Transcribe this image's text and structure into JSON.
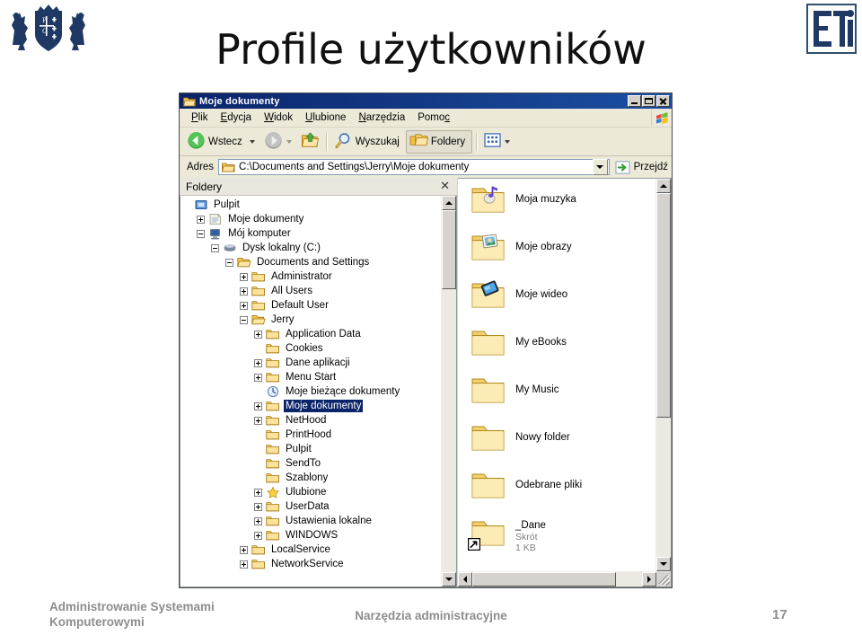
{
  "slide": {
    "title": "Profile użytkowników",
    "logo_left": "pg-coat-of-arms-logo",
    "logo_right": "eti-logo"
  },
  "footer": {
    "left_line1": "Administrowanie Systemami",
    "left_line2": "Komputerowymi",
    "center": "Narzędzia administracyjne",
    "page_number": "17"
  },
  "explorer": {
    "title": "Moje dokumenty",
    "title_icon": "folder-icon",
    "window_buttons": {
      "minimize": "minimize-button",
      "maximize": "maximize-button",
      "close": "close-button"
    },
    "menu": [
      {
        "label": "Plik",
        "accel": "P"
      },
      {
        "label": "Edycja",
        "accel": "E"
      },
      {
        "label": "Widok",
        "accel": "W"
      },
      {
        "label": "Ulubione",
        "accel": "U"
      },
      {
        "label": "Narzędzia",
        "accel": "N"
      },
      {
        "label": "Pomoc",
        "accel": "c"
      }
    ],
    "menu_logo": "windows-flag-icon",
    "toolbar": {
      "back": "Wstecz",
      "forward": "",
      "up": "up-one-level-icon",
      "search": "Wyszukaj",
      "folders": "Foldery",
      "views": "views-icon"
    },
    "address": {
      "label": "Adres",
      "value": "C:\\Documents and Settings\\Jerry\\Moje dokumenty",
      "icon": "folder-icon",
      "go_label": "Przejdź",
      "go_icon": "go-arrow-icon"
    },
    "folders_pane": {
      "title": "Foldery",
      "close_icon": "close-icon"
    },
    "tree": [
      {
        "label": "Pulpit",
        "indent": 0,
        "expander": "none",
        "icon": "desktop-icon",
        "selected": false
      },
      {
        "label": "Moje dokumenty",
        "indent": 1,
        "expander": "plus",
        "icon": "mydocs-icon",
        "selected": false
      },
      {
        "label": "Mój komputer",
        "indent": 1,
        "expander": "minus",
        "icon": "mycomputer-icon",
        "selected": false
      },
      {
        "label": "Dysk lokalny (C:)",
        "indent": 2,
        "expander": "minus",
        "icon": "harddrive-icon",
        "selected": false
      },
      {
        "label": "Documents and Settings",
        "indent": 3,
        "expander": "minus",
        "icon": "folder-open-icon",
        "selected": false
      },
      {
        "label": "Administrator",
        "indent": 4,
        "expander": "plus",
        "icon": "folder-icon",
        "selected": false
      },
      {
        "label": "All Users",
        "indent": 4,
        "expander": "plus",
        "icon": "folder-icon",
        "selected": false
      },
      {
        "label": "Default User",
        "indent": 4,
        "expander": "plus",
        "icon": "folder-icon",
        "selected": false
      },
      {
        "label": "Jerry",
        "indent": 4,
        "expander": "minus",
        "icon": "folder-open-icon",
        "selected": false
      },
      {
        "label": "Application Data",
        "indent": 5,
        "expander": "plus",
        "icon": "folder-icon",
        "selected": false
      },
      {
        "label": "Cookies",
        "indent": 5,
        "expander": "none",
        "icon": "folder-icon",
        "selected": false
      },
      {
        "label": "Dane aplikacji",
        "indent": 5,
        "expander": "plus",
        "icon": "folder-icon",
        "selected": false
      },
      {
        "label": "Menu Start",
        "indent": 5,
        "expander": "plus",
        "icon": "folder-icon",
        "selected": false
      },
      {
        "label": "Moje bieżące dokumenty",
        "indent": 5,
        "expander": "none",
        "icon": "recent-docs-icon",
        "selected": false
      },
      {
        "label": "Moje dokumenty",
        "indent": 5,
        "expander": "plus",
        "icon": "folder-icon",
        "selected": true
      },
      {
        "label": "NetHood",
        "indent": 5,
        "expander": "plus",
        "icon": "folder-icon",
        "selected": false
      },
      {
        "label": "PrintHood",
        "indent": 5,
        "expander": "none",
        "icon": "folder-icon",
        "selected": false
      },
      {
        "label": "Pulpit",
        "indent": 5,
        "expander": "none",
        "icon": "folder-icon",
        "selected": false
      },
      {
        "label": "SendTo",
        "indent": 5,
        "expander": "none",
        "icon": "folder-icon",
        "selected": false
      },
      {
        "label": "Szablony",
        "indent": 5,
        "expander": "none",
        "icon": "folder-icon",
        "selected": false
      },
      {
        "label": "Ulubione",
        "indent": 5,
        "expander": "plus",
        "icon": "favorites-star-icon",
        "selected": false
      },
      {
        "label": "UserData",
        "indent": 5,
        "expander": "plus",
        "icon": "folder-icon",
        "selected": false
      },
      {
        "label": "Ustawienia lokalne",
        "indent": 5,
        "expander": "plus",
        "icon": "folder-icon",
        "selected": false
      },
      {
        "label": "WINDOWS",
        "indent": 5,
        "expander": "plus",
        "icon": "folder-icon",
        "selected": false
      },
      {
        "label": "LocalService",
        "indent": 4,
        "expander": "plus",
        "icon": "folder-icon",
        "selected": false
      },
      {
        "label": "NetworkService",
        "indent": 4,
        "expander": "plus",
        "icon": "folder-icon",
        "selected": false
      }
    ],
    "files": [
      {
        "name": "Moja muzyka",
        "icon": "my-music-folder-icon",
        "type": "",
        "size": ""
      },
      {
        "name": "Moje obrazy",
        "icon": "my-pictures-folder-icon",
        "type": "",
        "size": ""
      },
      {
        "name": "Moje wideo",
        "icon": "my-video-folder-icon",
        "type": "",
        "size": ""
      },
      {
        "name": "My eBooks",
        "icon": "folder-icon",
        "type": "",
        "size": ""
      },
      {
        "name": "My Music",
        "icon": "folder-icon",
        "type": "",
        "size": ""
      },
      {
        "name": "Nowy folder",
        "icon": "folder-icon",
        "type": "",
        "size": ""
      },
      {
        "name": "Odebrane pliki",
        "icon": "folder-icon",
        "type": "",
        "size": ""
      },
      {
        "name": "_Dane",
        "icon": "shortcut-folder-icon",
        "type": "Skrót",
        "size": "1 KB"
      }
    ]
  },
  "colors": {
    "titlebar": "#0a246a",
    "selection": "#0a246a",
    "chrome": "#ece9d8",
    "window_face": "#d6d3ce",
    "folder_yellow": "#fcdf7e",
    "footer_text": "#8d8d8d"
  }
}
